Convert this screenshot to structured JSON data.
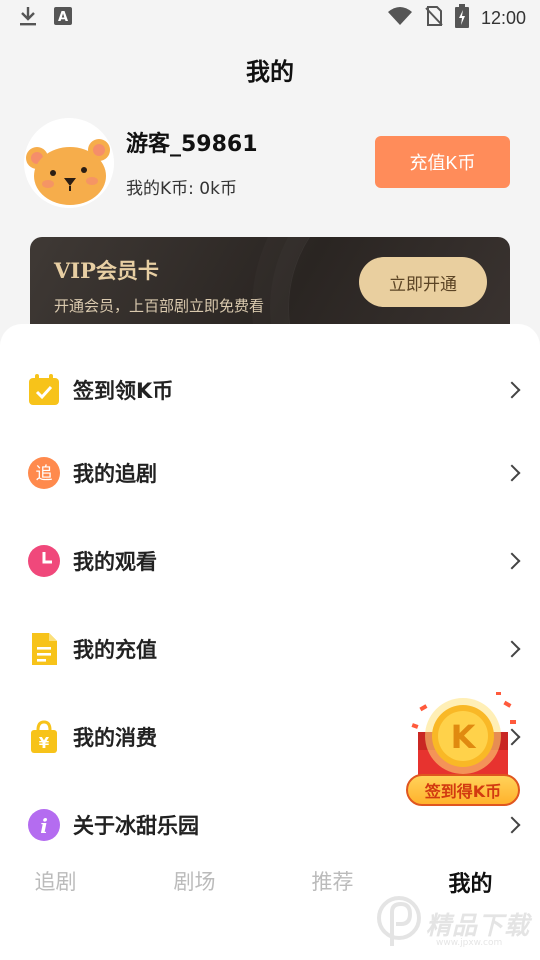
{
  "status_bar": {
    "time": "12:00"
  },
  "page": {
    "title": "我的"
  },
  "profile": {
    "username": "游客_59861",
    "coin_text": "我的K币: 0k币",
    "recharge_label": "充值K币"
  },
  "vip": {
    "title": "VIP会员卡",
    "subtitle": "开通会员，上百部剧立即免费看",
    "button": "立即开通"
  },
  "menu": {
    "items": [
      {
        "label": "签到领K币",
        "icon": "calendar-check-icon",
        "color": "#f7c31a"
      },
      {
        "label": "我的追剧",
        "icon": "follow-icon",
        "color": "#ff8a4d",
        "glyph": "追"
      },
      {
        "label": "我的观看",
        "icon": "clock-icon",
        "color": "#f0487b"
      },
      {
        "label": "我的充值",
        "icon": "document-icon",
        "color": "#f7c31a"
      },
      {
        "label": "我的消费",
        "icon": "shopping-bag-icon",
        "color": "#f7c31a",
        "glyph": "¥"
      },
      {
        "label": "关于冰甜乐园",
        "icon": "info-icon",
        "color": "#b46cf0",
        "glyph": "i"
      }
    ]
  },
  "promo": {
    "coin_letter": "K",
    "label": "签到得K币"
  },
  "tabs": {
    "items": [
      {
        "label": "追剧"
      },
      {
        "label": "剧场"
      },
      {
        "label": "推荐"
      },
      {
        "label": "我的",
        "active": true
      }
    ]
  },
  "watermark": {
    "text": "精品下载",
    "sub": "www.jpxw.com"
  }
}
